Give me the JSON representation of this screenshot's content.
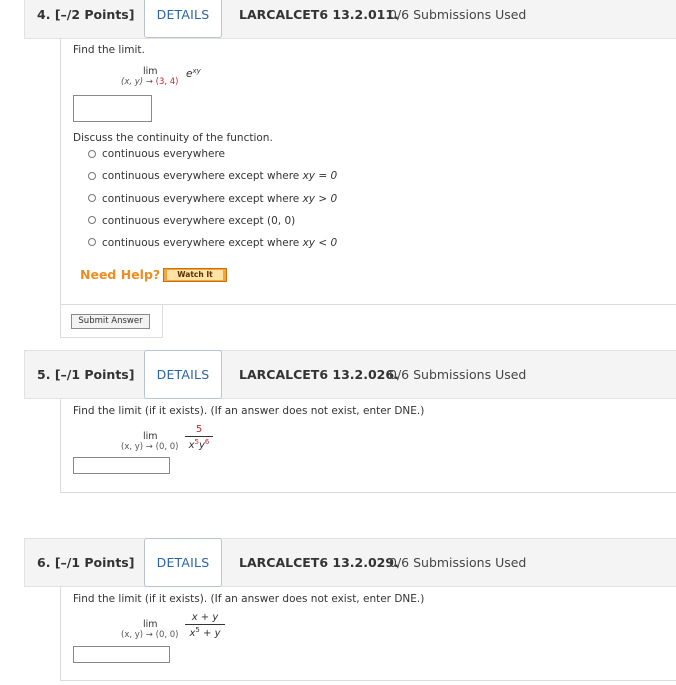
{
  "questions": [
    {
      "number": "4.",
      "points": "[–/2 Points]",
      "details_label": "DETAILS",
      "code": "LARCALCET6 13.2.011.",
      "submissions": "0/6 Submissions Used",
      "prompt": "Find the limit.",
      "lim_label": "lim",
      "lim_sub_vars": "(x, y)",
      "lim_arrow": "→",
      "lim_point": "(3, 4)",
      "expr_base": "e",
      "expr_exp": "xy",
      "continuity_prompt": "Discuss the continuity of the function.",
      "options": [
        {
          "text": "continuous everywhere",
          "math": ""
        },
        {
          "text": "continuous everywhere except where",
          "math": "xy = 0"
        },
        {
          "text": "continuous everywhere except where",
          "math": "xy > 0"
        },
        {
          "text": "continuous everywhere except (0, 0)",
          "math": ""
        },
        {
          "text": "continuous everywhere except where",
          "math": "xy < 0"
        }
      ],
      "need_help": "Need Help?",
      "watch_it": "Watch It",
      "submit_label": "Submit Answer"
    },
    {
      "number": "5.",
      "points": "[–/1 Points]",
      "details_label": "DETAILS",
      "code": "LARCALCET6 13.2.026.",
      "submissions": "0/6 Submissions Used",
      "prompt": "Find the limit (if it exists). (If an answer does not exist, enter DNE.)",
      "lim_label": "lim",
      "lim_sub": "(x, y) → (0, 0)",
      "numerator": "5",
      "den_x": "x",
      "den_x_exp": "5",
      "den_y": "y",
      "den_y_exp": "6"
    },
    {
      "number": "6.",
      "points": "[–/1 Points]",
      "details_label": "DETAILS",
      "code": "LARCALCET6 13.2.029.",
      "submissions": "0/6 Submissions Used",
      "prompt": "Find the limit (if it exists). (If an answer does not exist, enter DNE.)",
      "lim_label": "lim",
      "lim_sub": "(x, y) → (0, 0)",
      "numerator": "x + y",
      "den_x": "x",
      "den_x_exp": "5",
      "den_rest": "+ y"
    }
  ],
  "colors": {
    "accent_link": "#2a64a8",
    "help_orange": "#f08c1e",
    "limit_point_red": "#c0272d"
  }
}
